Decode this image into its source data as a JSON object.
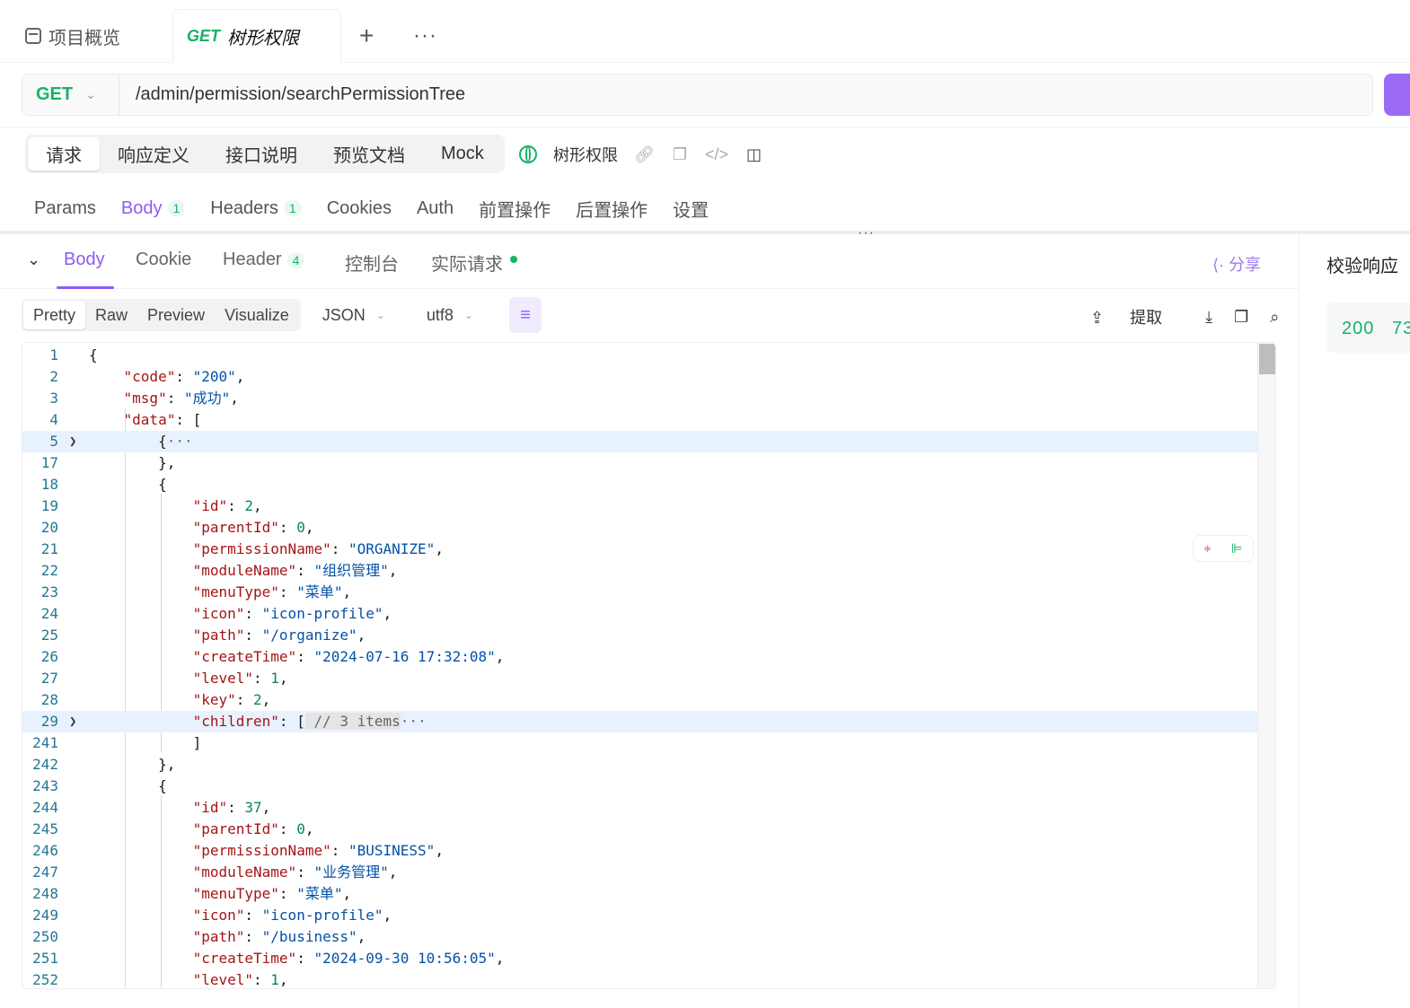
{
  "tabs": {
    "overview_label": "项目概览",
    "active_method": "GET",
    "active_label": "树形权限",
    "plus": "+",
    "more": "···"
  },
  "request": {
    "method": "GET",
    "url": "/admin/permission/searchPermissionTree"
  },
  "segments": [
    "请求",
    "响应定义",
    "接口说明",
    "预览文档",
    "Mock"
  ],
  "api_name": "树形权限",
  "req_tabs": {
    "params": "Params",
    "body": "Body",
    "body_count": "1",
    "headers": "Headers",
    "headers_count": "1",
    "cookies": "Cookies",
    "auth": "Auth",
    "pre": "前置操作",
    "post": "后置操作",
    "settings": "设置"
  },
  "resp_tabs": {
    "body": "Body",
    "cookie": "Cookie",
    "header": "Header",
    "header_count": "4",
    "console": "控制台",
    "actual": "实际请求",
    "share": "分享"
  },
  "format": {
    "modes": [
      "Pretty",
      "Raw",
      "Preview",
      "Visualize"
    ],
    "lang": "JSON",
    "encoding": "utf8",
    "extract": "提取"
  },
  "right_panel": {
    "title": "校验响应",
    "status": "200",
    "time": "73"
  },
  "code_lines": [
    {
      "n": "1",
      "indent": 0,
      "parts": [
        [
          "p",
          "{"
        ]
      ]
    },
    {
      "n": "2",
      "indent": 1,
      "parts": [
        [
          "k",
          "\"code\""
        ],
        [
          "p",
          ": "
        ],
        [
          "s",
          "\"200\""
        ],
        [
          "p",
          ","
        ]
      ]
    },
    {
      "n": "3",
      "indent": 1,
      "parts": [
        [
          "k",
          "\"msg\""
        ],
        [
          "p",
          ": "
        ],
        [
          "s",
          "\"成功\""
        ],
        [
          "p",
          ","
        ]
      ]
    },
    {
      "n": "4",
      "indent": 1,
      "parts": [
        [
          "k",
          "\"data\""
        ],
        [
          "p",
          ": ["
        ]
      ]
    },
    {
      "n": "5",
      "indent": 2,
      "fold": true,
      "hl": true,
      "parts": [
        [
          "p",
          "{"
        ],
        [
          "g",
          "···"
        ]
      ]
    },
    {
      "n": "17",
      "indent": 2,
      "parts": [
        [
          "p",
          "},"
        ]
      ]
    },
    {
      "n": "18",
      "indent": 2,
      "parts": [
        [
          "p",
          "{"
        ]
      ]
    },
    {
      "n": "19",
      "indent": 3,
      "parts": [
        [
          "k",
          "\"id\""
        ],
        [
          "p",
          ": "
        ],
        [
          "n",
          "2"
        ],
        [
          "p",
          ","
        ]
      ]
    },
    {
      "n": "20",
      "indent": 3,
      "parts": [
        [
          "k",
          "\"parentId\""
        ],
        [
          "p",
          ": "
        ],
        [
          "n",
          "0"
        ],
        [
          "p",
          ","
        ]
      ]
    },
    {
      "n": "21",
      "indent": 3,
      "parts": [
        [
          "k",
          "\"permissionName\""
        ],
        [
          "p",
          ": "
        ],
        [
          "s",
          "\"ORGANIZE\""
        ],
        [
          "p",
          ","
        ]
      ]
    },
    {
      "n": "22",
      "indent": 3,
      "parts": [
        [
          "k",
          "\"moduleName\""
        ],
        [
          "p",
          ": "
        ],
        [
          "s",
          "\"组织管理\""
        ],
        [
          "p",
          ","
        ]
      ]
    },
    {
      "n": "23",
      "indent": 3,
      "parts": [
        [
          "k",
          "\"menuType\""
        ],
        [
          "p",
          ": "
        ],
        [
          "s",
          "\"菜单\""
        ],
        [
          "p",
          ","
        ]
      ]
    },
    {
      "n": "24",
      "indent": 3,
      "parts": [
        [
          "k",
          "\"icon\""
        ],
        [
          "p",
          ": "
        ],
        [
          "s",
          "\"icon-profile\""
        ],
        [
          "p",
          ","
        ]
      ]
    },
    {
      "n": "25",
      "indent": 3,
      "parts": [
        [
          "k",
          "\"path\""
        ],
        [
          "p",
          ": "
        ],
        [
          "s",
          "\"/organize\""
        ],
        [
          "p",
          ","
        ]
      ]
    },
    {
      "n": "26",
      "indent": 3,
      "parts": [
        [
          "k",
          "\"createTime\""
        ],
        [
          "p",
          ": "
        ],
        [
          "s",
          "\"2024-07-16 17:32:08\""
        ],
        [
          "p",
          ","
        ]
      ]
    },
    {
      "n": "27",
      "indent": 3,
      "parts": [
        [
          "k",
          "\"level\""
        ],
        [
          "p",
          ": "
        ],
        [
          "n",
          "1"
        ],
        [
          "p",
          ","
        ]
      ]
    },
    {
      "n": "28",
      "indent": 3,
      "parts": [
        [
          "k",
          "\"key\""
        ],
        [
          "p",
          ": "
        ],
        [
          "n",
          "2"
        ],
        [
          "p",
          ","
        ]
      ]
    },
    {
      "n": "29",
      "indent": 3,
      "fold": true,
      "hl": true,
      "parts": [
        [
          "k",
          "\"children\""
        ],
        [
          "p",
          ": ["
        ],
        [
          "b",
          " // 3 items"
        ],
        [
          "g",
          "···"
        ]
      ]
    },
    {
      "n": "241",
      "indent": 3,
      "parts": [
        [
          "p",
          "]"
        ]
      ]
    },
    {
      "n": "242",
      "indent": 2,
      "parts": [
        [
          "p",
          "},"
        ]
      ]
    },
    {
      "n": "243",
      "indent": 2,
      "parts": [
        [
          "p",
          "{"
        ]
      ]
    },
    {
      "n": "244",
      "indent": 3,
      "parts": [
        [
          "k",
          "\"id\""
        ],
        [
          "p",
          ": "
        ],
        [
          "n",
          "37"
        ],
        [
          "p",
          ","
        ]
      ]
    },
    {
      "n": "245",
      "indent": 3,
      "parts": [
        [
          "k",
          "\"parentId\""
        ],
        [
          "p",
          ": "
        ],
        [
          "n",
          "0"
        ],
        [
          "p",
          ","
        ]
      ]
    },
    {
      "n": "246",
      "indent": 3,
      "parts": [
        [
          "k",
          "\"permissionName\""
        ],
        [
          "p",
          ": "
        ],
        [
          "s",
          "\"BUSINESS\""
        ],
        [
          "p",
          ","
        ]
      ]
    },
    {
      "n": "247",
      "indent": 3,
      "parts": [
        [
          "k",
          "\"moduleName\""
        ],
        [
          "p",
          ": "
        ],
        [
          "s",
          "\"业务管理\""
        ],
        [
          "p",
          ","
        ]
      ]
    },
    {
      "n": "248",
      "indent": 3,
      "parts": [
        [
          "k",
          "\"menuType\""
        ],
        [
          "p",
          ": "
        ],
        [
          "s",
          "\"菜单\""
        ],
        [
          "p",
          ","
        ]
      ]
    },
    {
      "n": "249",
      "indent": 3,
      "parts": [
        [
          "k",
          "\"icon\""
        ],
        [
          "p",
          ": "
        ],
        [
          "s",
          "\"icon-profile\""
        ],
        [
          "p",
          ","
        ]
      ]
    },
    {
      "n": "250",
      "indent": 3,
      "parts": [
        [
          "k",
          "\"path\""
        ],
        [
          "p",
          ": "
        ],
        [
          "s",
          "\"/business\""
        ],
        [
          "p",
          ","
        ]
      ]
    },
    {
      "n": "251",
      "indent": 3,
      "parts": [
        [
          "k",
          "\"createTime\""
        ],
        [
          "p",
          ": "
        ],
        [
          "s",
          "\"2024-09-30 10:56:05\""
        ],
        [
          "p",
          ","
        ]
      ]
    },
    {
      "n": "252",
      "indent": 3,
      "parts": [
        [
          "k",
          "\"level\""
        ],
        [
          "p",
          ": "
        ],
        [
          "n",
          "1"
        ],
        [
          "p",
          ","
        ]
      ]
    }
  ]
}
